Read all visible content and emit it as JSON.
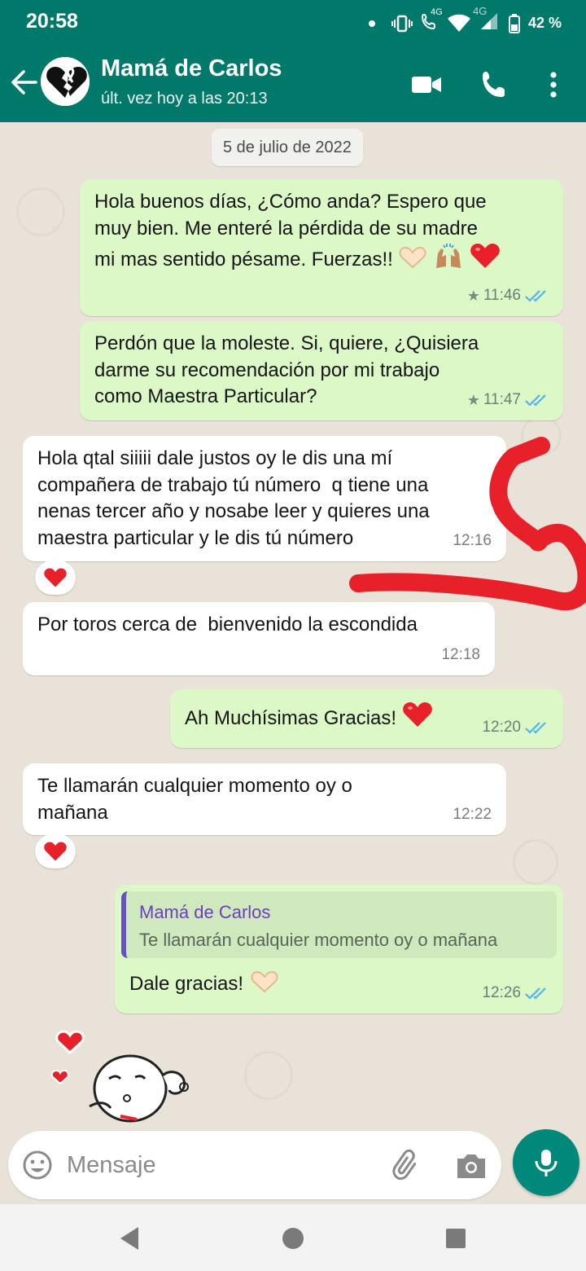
{
  "status_bar": {
    "time": "20:58",
    "network_label_1": "4G",
    "network_label_2": "4G",
    "battery": "42 %"
  },
  "header": {
    "contact_name": "Mamá de Carlos",
    "last_seen": "últ. vez hoy a las 20:13",
    "icons": [
      "back-arrow-icon",
      "video-call-icon",
      "phone-icon",
      "more-options-icon"
    ]
  },
  "chat": {
    "date_chip": "5 de julio de 2022",
    "messages": [
      {
        "direction": "outgoing",
        "lines": [
          "Hola buenos días, ¿Cómo anda? Espero que",
          "muy bien. Me enteré la pérdida de su madre",
          "mi mas sentido pésame. Fuerzas!!"
        ],
        "emojis": [
          "heart-hands-emoji",
          "raising-hands-emoji",
          "red-heart-emoji"
        ],
        "time": "11:46",
        "starred": true,
        "status": "read"
      },
      {
        "direction": "outgoing",
        "lines": [
          "Perdón que la moleste. Si, quiere, ¿Quisiera",
          "darme su recomendación por mi trabajo",
          "como Maestra Particular?"
        ],
        "time": "11:47",
        "starred": true,
        "status": "read"
      },
      {
        "direction": "incoming",
        "lines": [
          "Hola qtal siiiii dale justos oy le dis una mí",
          "compañera de trabajo tú número  q tiene una",
          "nenas tercer año y nosabe leer y quieres una",
          "maestra particular y le dis tú número"
        ],
        "time": "12:16",
        "reaction": "red-heart-emoji"
      },
      {
        "direction": "incoming",
        "lines": [
          "Por toros cerca de  bienvenido la escondida"
        ],
        "time": "12:18"
      },
      {
        "direction": "outgoing",
        "lines": [
          "Ah Muchísimas Gracias!"
        ],
        "emojis": [
          "red-heart-emoji"
        ],
        "time": "12:20",
        "status": "read"
      },
      {
        "direction": "incoming",
        "lines": [
          "Te llamarán cualquier momento oy o",
          "mañana"
        ],
        "time": "12:22",
        "reaction": "red-heart-emoji"
      },
      {
        "direction": "outgoing",
        "quote_name": "Mamá de Carlos",
        "quote_text": "Te llamarán cualquier momento oy o mañana",
        "lines": [
          "Dale gracias!"
        ],
        "emojis": [
          "heart-hands-emoji"
        ],
        "time": "12:26",
        "status": "read"
      }
    ],
    "sticker": "blowing-kiss-sticker",
    "annotation_color": "#e8202a"
  },
  "composer": {
    "placeholder": "Mensaje",
    "icons": [
      "emoji-icon",
      "attach-icon",
      "camera-icon",
      "mic-icon"
    ]
  },
  "colors": {
    "header": "#00796b",
    "outgoing_bubble": "#dcf8c6",
    "incoming_bubble": "#ffffff",
    "read_ticks": "#4fb6ec",
    "fab": "#00897b"
  }
}
